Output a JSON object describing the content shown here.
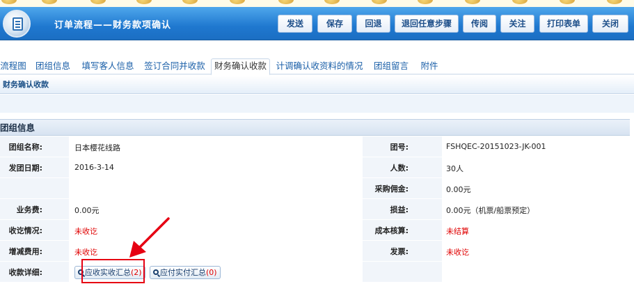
{
  "window": {
    "title": "订单流程——财务款项确认"
  },
  "toolbar": {
    "buttons": [
      "发送",
      "保存",
      "回退",
      "退回任意步骤",
      "传阅",
      "关注",
      "打印表单",
      "关闭"
    ]
  },
  "tabs": [
    "流程图",
    "团组信息",
    "填写客人信息",
    "签订合同并收款",
    "财务确认收款",
    "计调确认收资料的情况",
    "团组留言",
    "附件"
  ],
  "active_tab": "财务确认收款",
  "section": {
    "title": "财务确认收款"
  },
  "group_info": {
    "heading": "团组信息",
    "rows": [
      {
        "l1": "团组名称:",
        "v1": "日本樱花线路",
        "l2": "团号:",
        "v2": "FSHQEC-20151023-JK-001"
      },
      {
        "l1": "发团日期:",
        "v1": "2016-3-14",
        "l2": "人数:",
        "v2": "30人"
      },
      {
        "l1": "",
        "v1": "",
        "l2": "采购佣金:",
        "v2": "0.00元"
      },
      {
        "l1": "业务费:",
        "v1": "0.00元",
        "l2": "损益:",
        "v2": "0.00元（机票/船票预定）"
      },
      {
        "l1": "收讫情况:",
        "v1": "未收讫",
        "l2": "成本核算:",
        "v2": "未结算"
      },
      {
        "l1": "增减费用:",
        "v1": "未收讫",
        "l2": "发票:",
        "v2": "未收讫"
      }
    ],
    "detail": {
      "label": "收款详细:",
      "receivable_button": "应收实收汇总",
      "receivable_count": "(2)",
      "payable_button": "应付实付汇总",
      "payable_count": "(0)"
    }
  },
  "colors": {
    "header": "#1f78cf",
    "status_red": "#e00000",
    "highlight": "#e60012"
  }
}
